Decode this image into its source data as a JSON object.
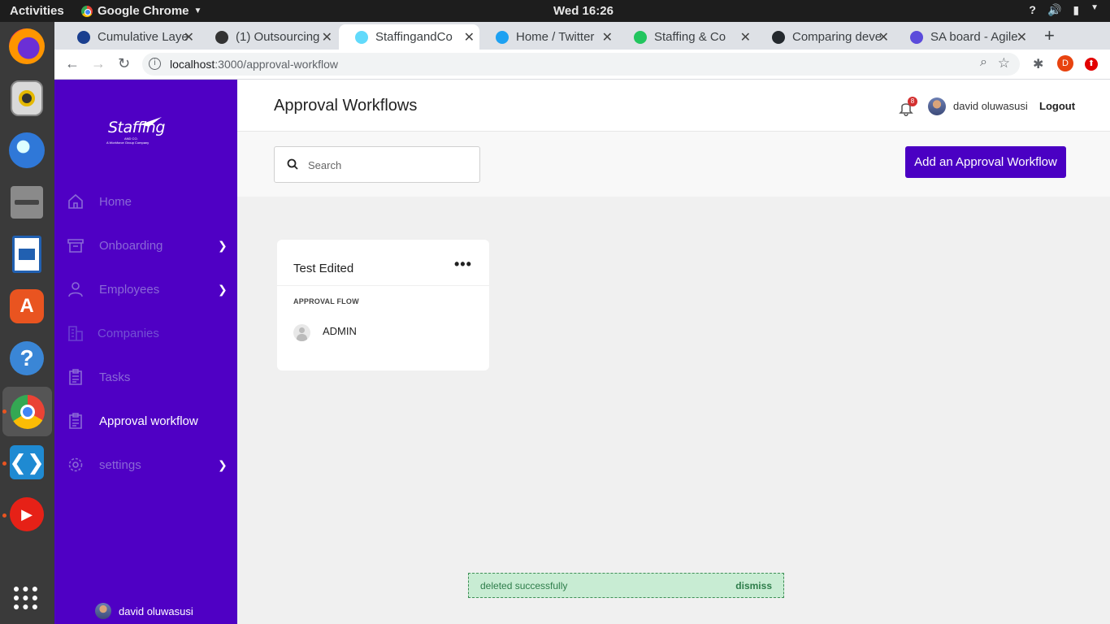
{
  "os": {
    "activities": "Activities",
    "app_name": "Google Chrome",
    "clock": "Wed 16:26"
  },
  "browser": {
    "tabs": [
      {
        "label": "Cumulative Laye",
        "favicon_color": "#1a3f8f"
      },
      {
        "label": "(1) Outsourcing",
        "favicon_color": "#333333"
      },
      {
        "label": "StaffingandCo",
        "favicon_color": "#61dafb"
      },
      {
        "label": "Home / Twitter",
        "favicon_color": "#1da1f2"
      },
      {
        "label": "Staffing & Co",
        "favicon_color": "#22c55e"
      },
      {
        "label": "Comparing deve",
        "favicon_color": "#24292e"
      },
      {
        "label": "SA board - Agile",
        "favicon_color": "#5b4bdb"
      }
    ],
    "active_tab_index": 2,
    "url_host": "localhost",
    "url_path": ":3000/approval-workflow",
    "profile_initial": "D"
  },
  "sidebar": {
    "brand": "Staffing",
    "brand_sub": "AND CO.",
    "brand_tag": "A Workforce Group Company",
    "items": [
      {
        "label": "Home",
        "icon": "home-icon"
      },
      {
        "label": "Onboarding",
        "icon": "archive-icon"
      },
      {
        "label": "Employees",
        "icon": "user-icon"
      },
      {
        "label": "Companies",
        "icon": "building-icon"
      },
      {
        "label": "Tasks",
        "icon": "clipboard-icon"
      },
      {
        "label": "Approval workflow",
        "icon": "clipboard-icon"
      },
      {
        "label": "settings",
        "icon": "gear-icon"
      }
    ],
    "active_item": "Approval workflow",
    "user_name": "david oluwasusi"
  },
  "header": {
    "title": "Approval Workflows",
    "notification_count": "8",
    "user_name": "david oluwasusi",
    "logout_label": "Logout"
  },
  "toolbar": {
    "search_placeholder": "Search",
    "add_button_label": "Add an Approval Workflow"
  },
  "workflows": [
    {
      "title": "Test Edited",
      "flow_label": "APPROVAL FLOW",
      "approvers": [
        "ADMIN"
      ]
    }
  ],
  "toast": {
    "message": "deleted successfully",
    "dismiss_label": "dismiss"
  },
  "colors": {
    "sidebar_bg": "#4f00c4",
    "primary_button": "#4a00c3",
    "toast_bg": "#c8ecd3",
    "toast_text": "#2e7d4a"
  }
}
